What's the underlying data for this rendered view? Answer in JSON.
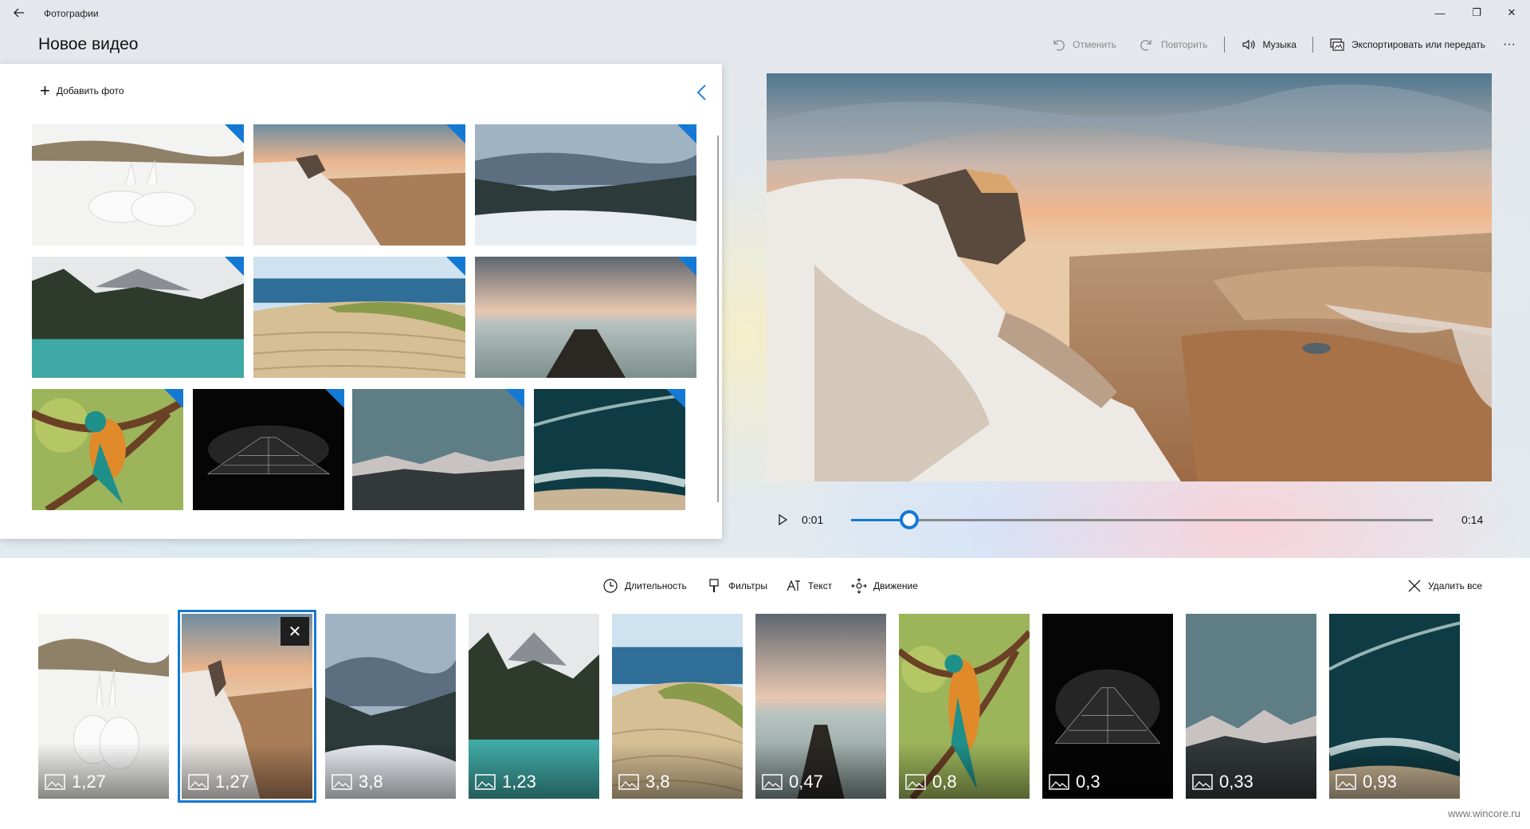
{
  "window": {
    "app_name": "Фотографии",
    "back_icon": "back-arrow-icon",
    "minimize": "—",
    "maximize": "❐",
    "close": "✕"
  },
  "page_title": "Новое видео",
  "toolbar": {
    "undo_label": "Отменить",
    "redo_label": "Повторить",
    "music_label": "Музыка",
    "export_label": "Экспортировать или передать",
    "more_label": "···"
  },
  "library": {
    "add_photo_label": "Добавить фото",
    "collapse_icon": "chevron-left-icon",
    "items": [
      {
        "scene": "hares"
      },
      {
        "scene": "cliff"
      },
      {
        "scene": "valley"
      },
      {
        "scene": "lake"
      },
      {
        "scene": "dunes"
      },
      {
        "scene": "pier"
      },
      {
        "scene": "parrot"
      },
      {
        "scene": "building"
      },
      {
        "scene": "mountains"
      },
      {
        "scene": "ocean"
      }
    ]
  },
  "player": {
    "current_time": "0:01",
    "total_time": "0:14",
    "progress": 0.1
  },
  "storyboard": {
    "tools": {
      "duration": "Длительность",
      "filters": "Фильтры",
      "text": "Текст",
      "motion": "Движение",
      "delete_all": "Удалить все"
    },
    "remove_label": "✕",
    "clips": [
      {
        "scene": "hares",
        "duration": "1,27"
      },
      {
        "scene": "cliff",
        "duration": "1,27",
        "selected": true
      },
      {
        "scene": "valley",
        "duration": "3,8"
      },
      {
        "scene": "lake",
        "duration": "1,23"
      },
      {
        "scene": "dunes",
        "duration": "3,8"
      },
      {
        "scene": "pier",
        "duration": "0,47"
      },
      {
        "scene": "parrot",
        "duration": "0,8"
      },
      {
        "scene": "building",
        "duration": "0,3"
      },
      {
        "scene": "mountains",
        "duration": "0,33"
      },
      {
        "scene": "ocean",
        "duration": "0,93"
      }
    ]
  },
  "watermark": "www.wincore.ru",
  "colors": {
    "accent": "#1479d4"
  }
}
